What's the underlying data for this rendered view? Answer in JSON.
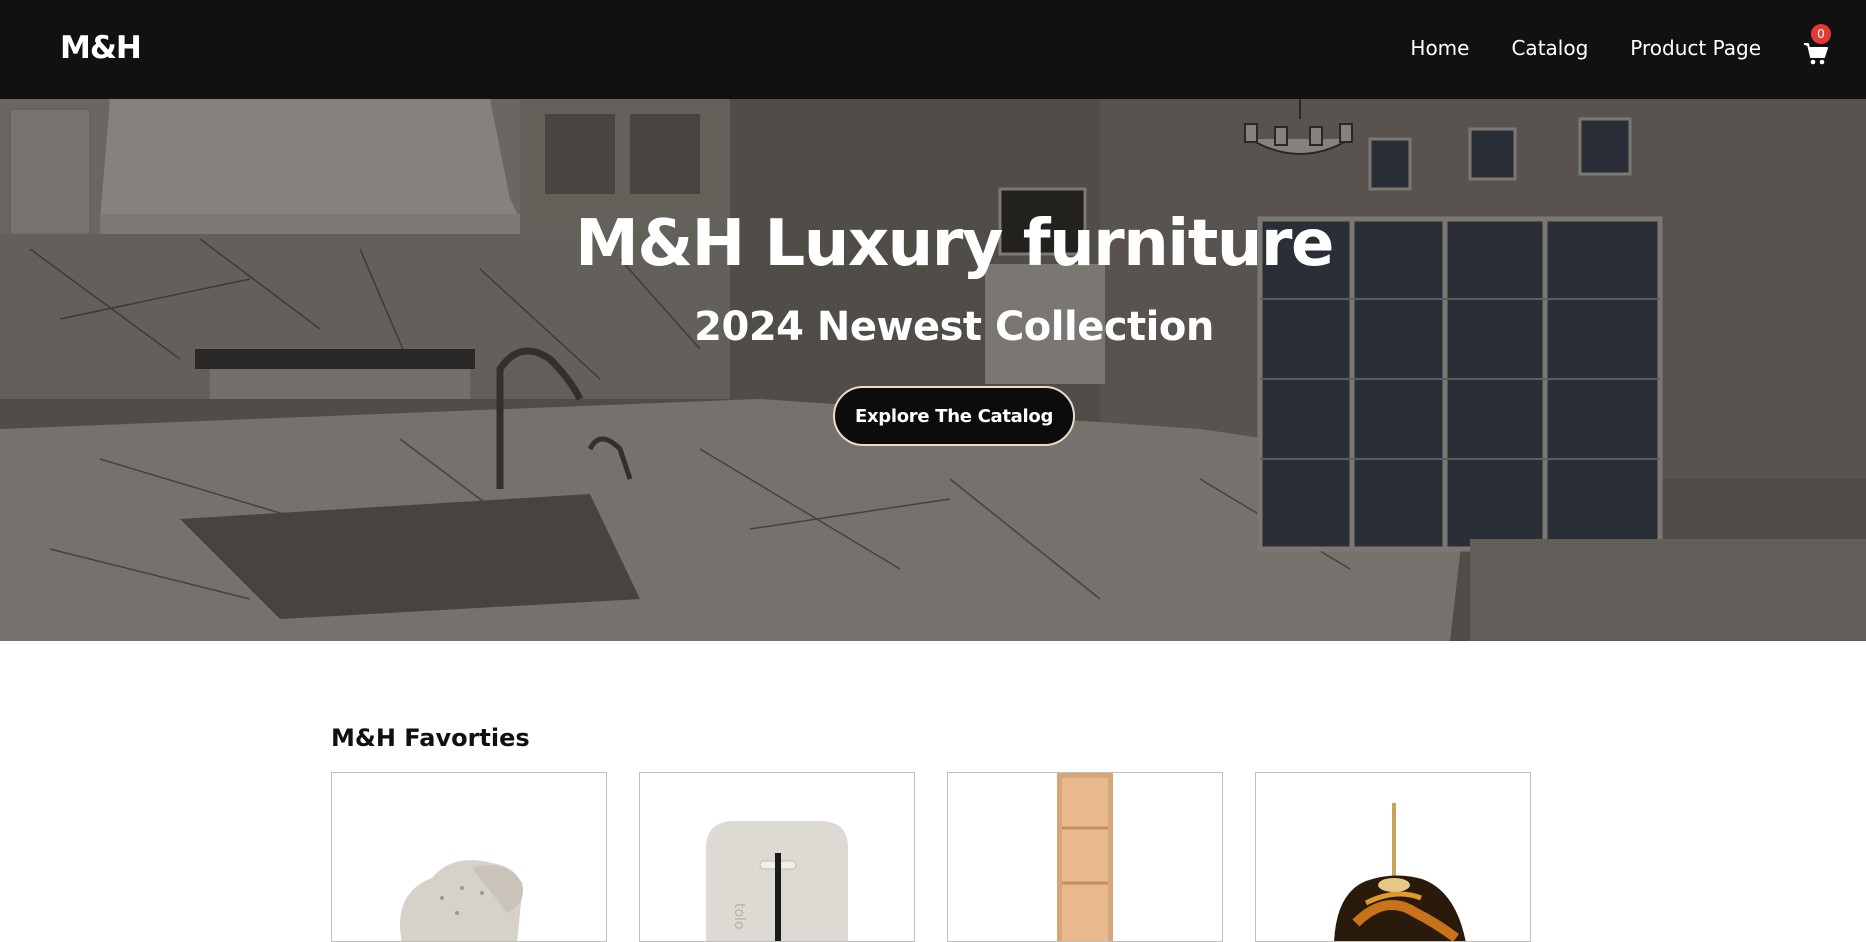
{
  "nav": {
    "logo": "M&H",
    "links": [
      "Home",
      "Catalog",
      "Product Page"
    ],
    "cart_count": "0"
  },
  "hero": {
    "title": "M&H Luxury furniture",
    "subtitle": "2024 Newest Collection",
    "cta": "Explore The Catalog"
  },
  "favorites": {
    "title": "M&H Favorties",
    "products": [
      {
        "image": "armchair"
      },
      {
        "image": "lamp"
      },
      {
        "image": "bookshelf"
      },
      {
        "image": "pendant-light"
      }
    ]
  },
  "colors": {
    "navbar": "#111111",
    "badge": "#e53935",
    "button_border": "#e8dcc4"
  }
}
